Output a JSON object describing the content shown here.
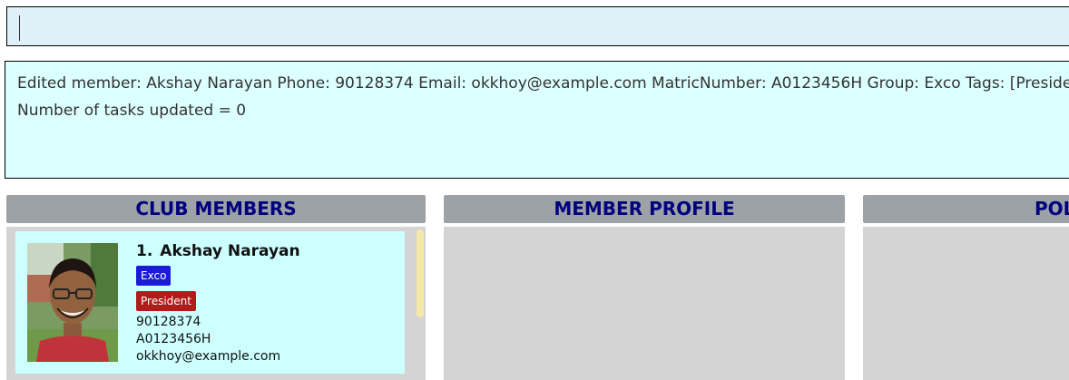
{
  "command_box": {
    "value": "",
    "placeholder": ""
  },
  "result_display": {
    "line1": "Edited member: Akshay Narayan Phone: 90128374 Email: okkhoy@example.com MatricNumber: A0123456H Group: Exco Tags: [President]",
    "line2": "Number of tasks updated = 0"
  },
  "panels": {
    "members_title": "CLUB MEMBERS",
    "profile_title": "MEMBER PROFILE",
    "third_title": "POL"
  },
  "members": [
    {
      "index": "1.",
      "name": "Akshay Narayan",
      "group": "Exco",
      "tag": "President",
      "phone": "90128374",
      "matric": "A0123456H",
      "email": "okkhoy@example.com"
    }
  ],
  "colors": {
    "header_text": "#00007f",
    "group_tag": "#1b1bd6",
    "role_tag": "#b31b1b",
    "card_bg": "#ceffff"
  }
}
